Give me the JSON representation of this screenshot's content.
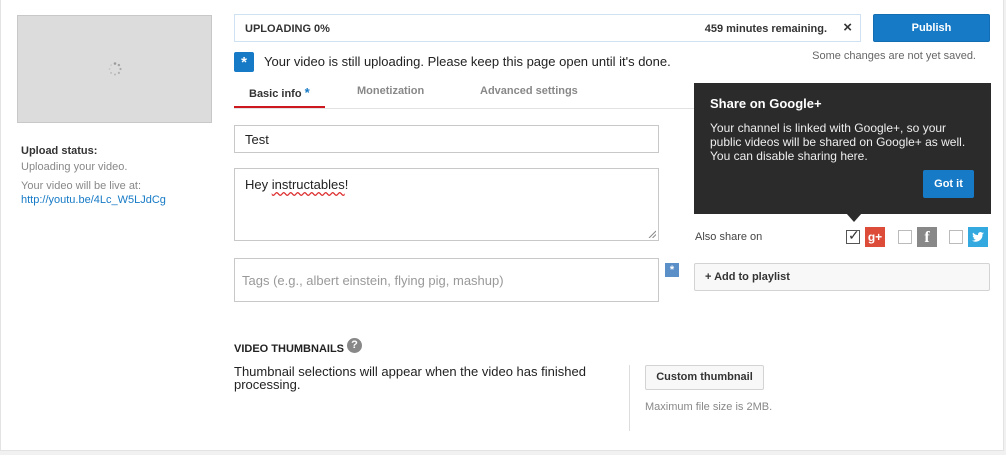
{
  "upload": {
    "progress_label": "UPLOADING 0%",
    "progress_fraction": 0,
    "remaining": "459 minutes remaining.",
    "close_symbol": "×"
  },
  "publish_label": "Publish",
  "not_saved": "Some changes are not yet saved.",
  "notice": {
    "icon_symbol": "*",
    "text": "Your video is still uploading. Please keep this page open until it's done."
  },
  "sidebar": {
    "status_title": "Upload status:",
    "status_text": "Uploading your video.",
    "live_text": "Your video will be live at:",
    "live_link": "http://youtu.be/4Lc_W5LJdCg"
  },
  "tabs": [
    {
      "label": "Basic info",
      "active": true
    },
    {
      "label": "Monetization",
      "active": false
    },
    {
      "label": "Advanced settings",
      "active": false
    }
  ],
  "tab_star": "*",
  "form": {
    "title_value": "Test",
    "description_prefix": "Hey ",
    "description_misspelled": "instructables",
    "description_suffix": "!",
    "tags_placeholder": "Tags (e.g., albert einstein, flying pig, mashup)"
  },
  "tooltip": {
    "title": "Share on Google+",
    "body": "Your channel is linked with Google+, so your public videos will be shared on Google+ as well. You can disable sharing here.",
    "button": "Got it"
  },
  "share": {
    "label": "Also share on",
    "google_checked": true,
    "facebook_checked": false,
    "twitter_checked": false,
    "google_glyph": "g+",
    "facebook_glyph": "f"
  },
  "playlist_label": "+ Add to playlist",
  "thumbnails": {
    "title": "VIDEO THUMBNAILS",
    "help_symbol": "?",
    "text": "Thumbnail selections will appear when the video has finished processing.",
    "custom_button": "Custom thumbnail",
    "max_size": "Maximum file size is 2MB."
  },
  "colors": {
    "accent": "#167ac6",
    "active_tab_underline": "#cc181e",
    "google_red": "#dd4b39",
    "twitter_blue": "#33a9e0",
    "tooltip_bg": "#2b2b2b"
  }
}
